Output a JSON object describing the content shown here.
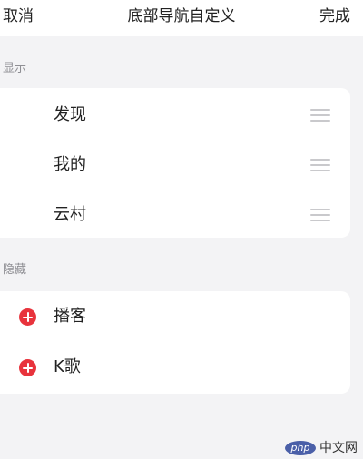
{
  "header": {
    "cancel_label": "取消",
    "title": "底部导航自定义",
    "done_label": "完成"
  },
  "sections": {
    "shown": {
      "label": "显示",
      "items": [
        {
          "label": "发现"
        },
        {
          "label": "我的"
        },
        {
          "label": "云村"
        }
      ]
    },
    "hidden": {
      "label": "隐藏",
      "items": [
        {
          "label": "播客"
        },
        {
          "label": "K歌"
        }
      ]
    }
  },
  "watermark": {
    "badge": "php",
    "text": "中文网"
  },
  "colors": {
    "accent": "#e8333c",
    "background": "#f3f3f5",
    "section_label": "#8f8f94",
    "drag_handle": "#c9c9cc"
  },
  "icons": {
    "row_add": "plus-circle-icon",
    "row_drag": "drag-handle-icon"
  }
}
